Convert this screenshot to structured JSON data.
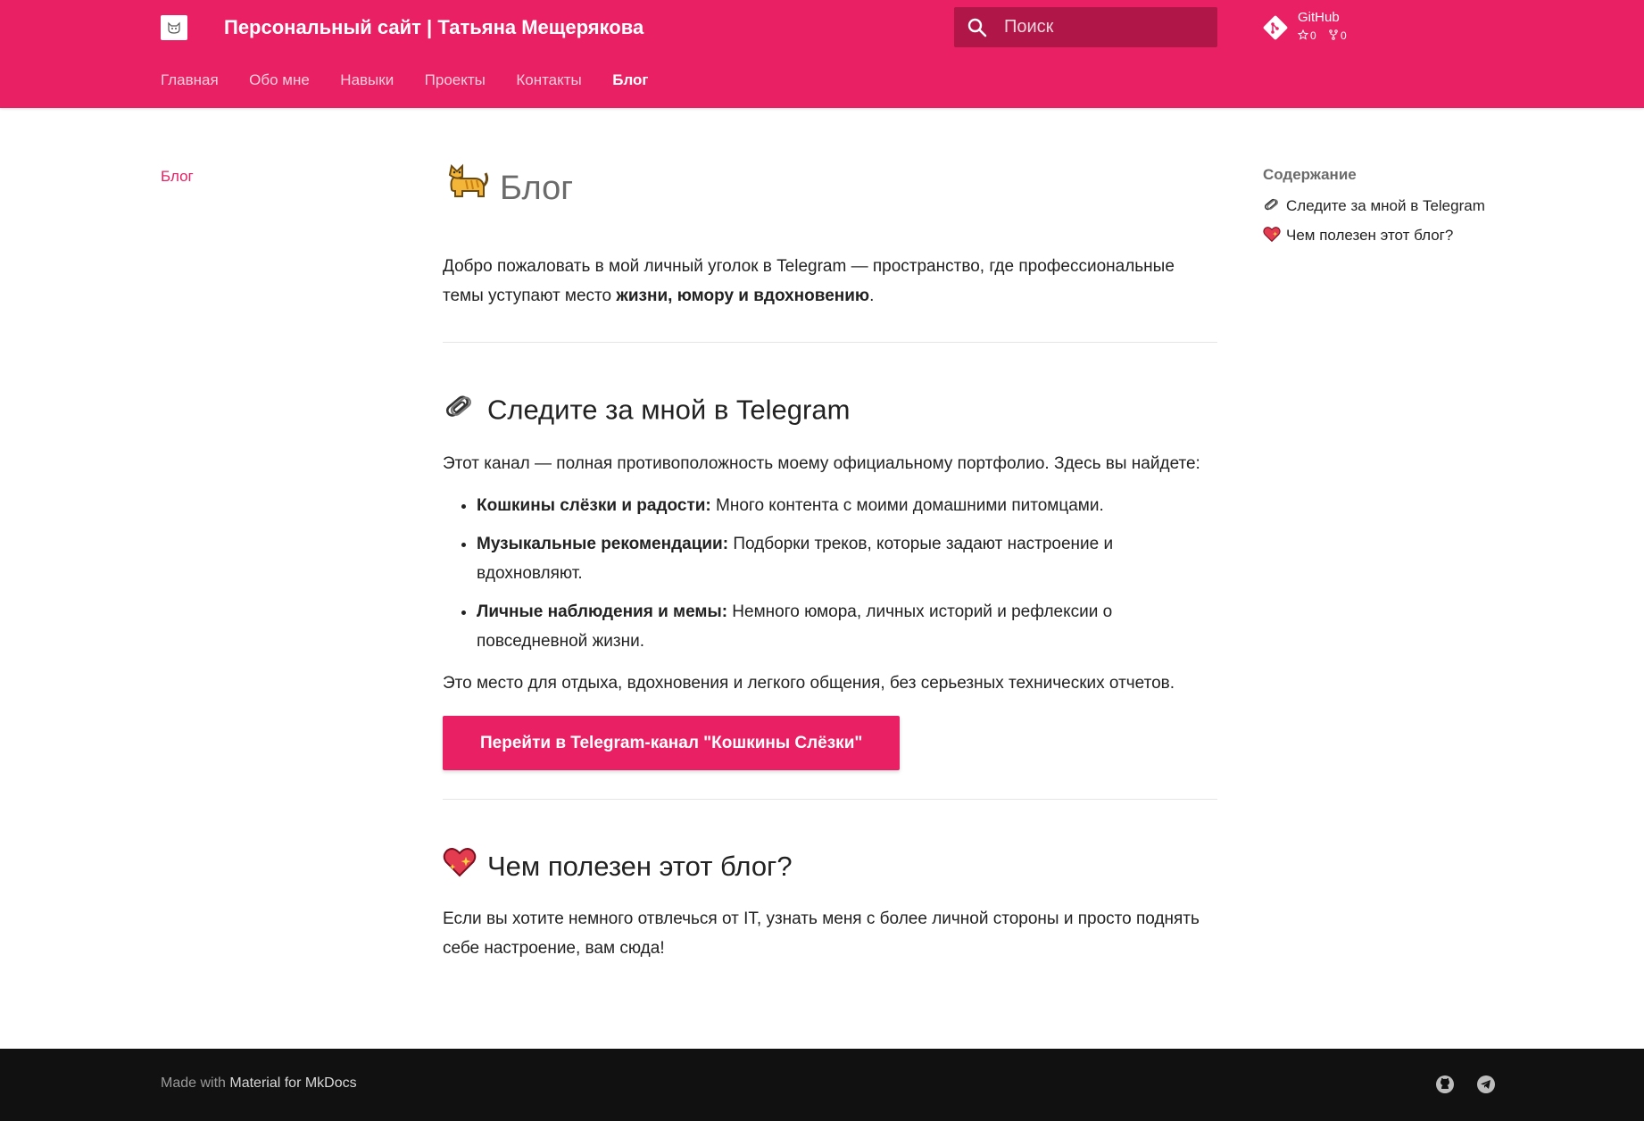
{
  "colors": {
    "primary": "#e92063",
    "search_bg": "#b01648",
    "footer_bg": "#111111"
  },
  "header": {
    "site_title": "Персональный сайт | Татьяна Мещерякова",
    "logo_icon": "cat-logo-icon",
    "search": {
      "placeholder": "Поиск",
      "icon": "search-icon"
    },
    "repo": {
      "name": "GitHub",
      "stars": "0",
      "forks": "0"
    }
  },
  "tabs": [
    {
      "label": "Главная"
    },
    {
      "label": "Обо мне"
    },
    {
      "label": "Навыки"
    },
    {
      "label": "Проекты"
    },
    {
      "label": "Контакты"
    },
    {
      "label": "Блог",
      "active": true
    }
  ],
  "left_nav": {
    "active_label": "Блог"
  },
  "main": {
    "title": "Блог",
    "intro_text": "Добро пожаловать в мой личный уголок в Telegram — пространство, где профессиональные темы уступают место ",
    "intro_bold": "жизни, юмору и вдохновению",
    "intro_end": ".",
    "section1": {
      "heading": "Следите за мной в Telegram",
      "text": "Этот канал — полная противоположность моему официальному портфолио. Здесь вы найдете:",
      "items": [
        {
          "bold": "Кошкины слёзки и радости:",
          "text": " Много контента с моими домашними питомцами."
        },
        {
          "bold": "Музыкальные рекомендации:",
          "text": " Подборки треков, которые задают настроение и вдохновляют."
        },
        {
          "bold": "Личные наблюдения и мемы:",
          "text": " Немного юмора, личных историй и рефлексии о повседневной жизни."
        }
      ],
      "outro": "Это место для отдыха, вдохновения и легкого общения, без серьезных технических отчетов.",
      "button": "Перейти в Telegram-канал \"Кошкины Слёзки\""
    },
    "section2": {
      "heading": "Чем полезен этот блог?",
      "text": "Если вы хотите немного отвлечься от IT, узнать меня с более личной стороны и просто поднять себе настроение, вам сюда!"
    }
  },
  "toc": {
    "title": "Содержание",
    "items": [
      {
        "label": "Следите за мной в Telegram",
        "icon": "paperclips-icon"
      },
      {
        "label": "Чем полезен этот блог?",
        "icon": "sparkling-heart-icon"
      }
    ]
  },
  "footer": {
    "made_with": "Made with",
    "material_link": "Material for MkDocs",
    "social": [
      "github-icon",
      "telegram-icon"
    ]
  }
}
